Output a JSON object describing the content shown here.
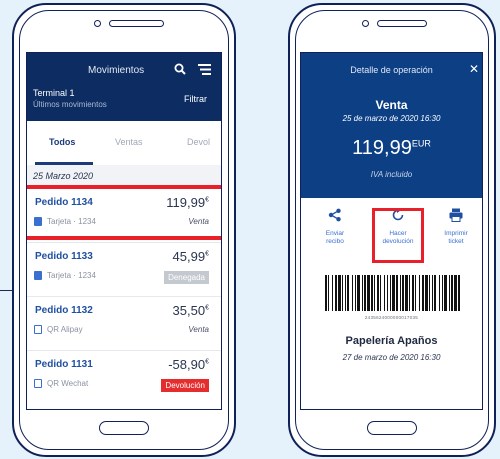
{
  "colors": {
    "background": "#e5f2fb",
    "navy": "#0d2d62",
    "accent_red": "#e8202a",
    "link_blue": "#1f4fa0"
  },
  "left_screen": {
    "header": {
      "title": "Movimientos",
      "terminal": "Terminal 1",
      "subtitle": "Últimos movimientos",
      "filter_label": "Filtrar"
    },
    "tabs": [
      "Todos",
      "Ventas",
      "Devol"
    ],
    "date_group": "25 Marzo 2020",
    "items": [
      {
        "title": "Pedido 1134",
        "amount": "119,99",
        "currency": "€",
        "method": "Tarjeta · 1234",
        "status": "Venta",
        "icon": "card-icon"
      },
      {
        "title": "Pedido 1133",
        "amount": "45,99",
        "currency": "€",
        "method": "Tarjeta · 1234",
        "status": "Denegada",
        "icon": "card-icon"
      },
      {
        "title": "Pedido 1132",
        "amount": "35,50",
        "currency": "€",
        "method": "QR Alipay",
        "status": "Venta",
        "icon": "qr-icon"
      },
      {
        "title": "Pedido 1131",
        "amount": "-58,90",
        "currency": "€",
        "method": "QR Wechat",
        "status": "Devolución",
        "icon": "qr-icon"
      }
    ]
  },
  "right_screen": {
    "header": {
      "title": "Detalle de operación",
      "close": "✕",
      "type": "Venta",
      "datetime": "25 de marzo de 2020 16:30",
      "amount": "119,99",
      "currency": "EUR",
      "tax_note": "IVA incluido"
    },
    "actions": [
      {
        "line1": "Enviar",
        "line2": "recibo",
        "icon": "share-icon"
      },
      {
        "line1": "Hacer",
        "line2": "devolución",
        "icon": "refresh-icon"
      },
      {
        "line1": "Imprimir",
        "line2": "ticket",
        "icon": "printer-icon"
      }
    ],
    "barcode_number": "2435624000000017035",
    "merchant": "Papelería Apaños",
    "merchant_datetime": "27 de marzo de 2020 16:30"
  }
}
